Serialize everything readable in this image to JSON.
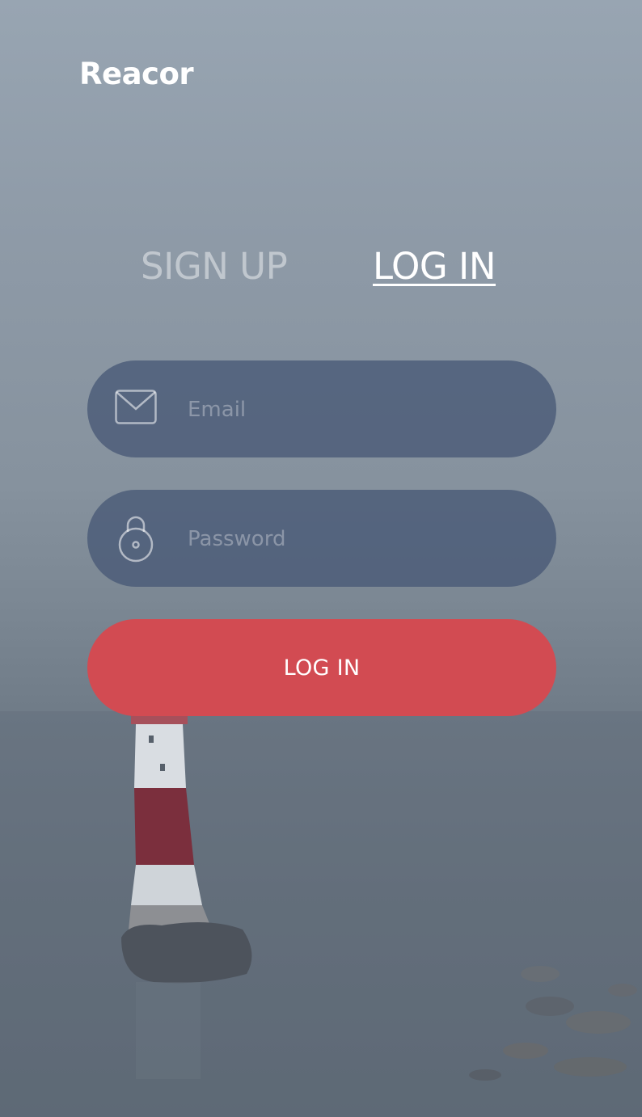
{
  "app": {
    "brand": "Reacor"
  },
  "tabs": {
    "signup_label": "SIGN UP",
    "login_label": "LOG IN",
    "active": "LOG IN"
  },
  "form": {
    "email": {
      "icon": "envelope-icon",
      "placeholder": "Email",
      "value": ""
    },
    "password": {
      "icon": "lock-icon",
      "placeholder": "Password",
      "value": ""
    },
    "submit_label": "LOG IN"
  },
  "colors": {
    "accent": "#d24b52",
    "field_bg": "#485876",
    "text": "#ffffff"
  }
}
